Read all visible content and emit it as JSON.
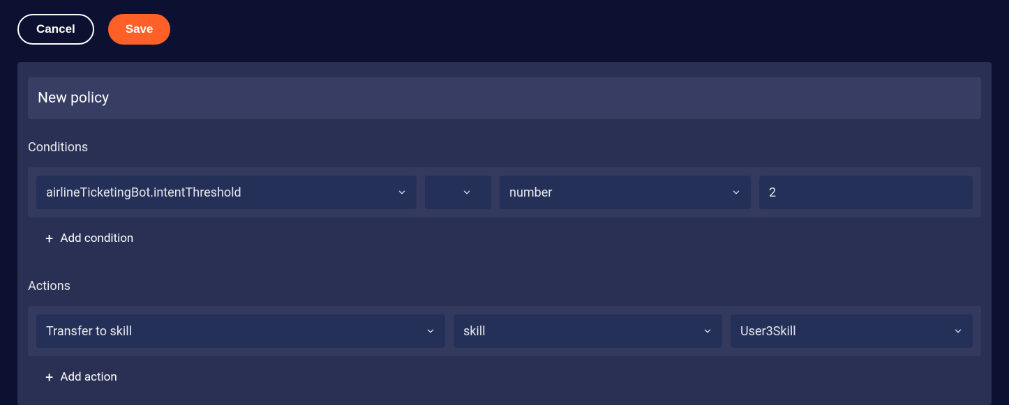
{
  "header": {
    "cancel_label": "Cancel",
    "save_label": "Save"
  },
  "panel": {
    "title": "New policy"
  },
  "conditions": {
    "label": "Conditions",
    "rows": [
      {
        "field": "airlineTicketingBot.intentThreshold",
        "operator": "<",
        "type": "number",
        "value": "2"
      }
    ],
    "add_label": "Add condition"
  },
  "actions": {
    "label": "Actions",
    "rows": [
      {
        "type": "Transfer to skill",
        "target": "skill",
        "value": "User3Skill"
      }
    ],
    "add_label": "Add action"
  }
}
